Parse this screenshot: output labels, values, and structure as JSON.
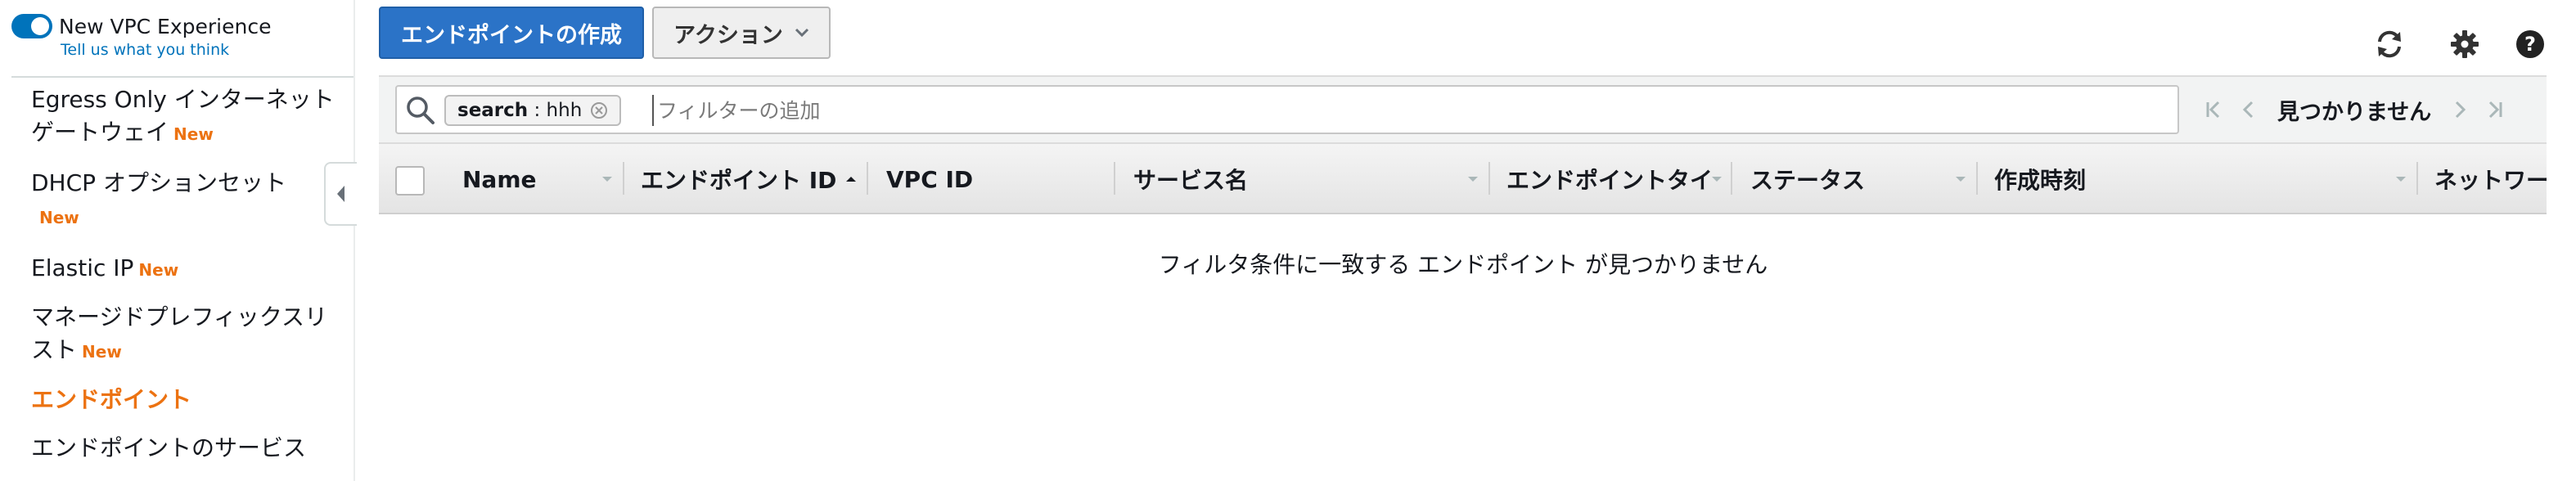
{
  "sidebar": {
    "toggle_label": "New VPC Experience",
    "feedback_link": "Tell us what you think",
    "new_badge": "New",
    "items": [
      {
        "label_line1": "Egress Only インターネット",
        "label_line2": "ゲートウェイ"
      },
      {
        "label_line1": "DHCP オプションセット"
      },
      {
        "label_line1": "Elastic IP"
      },
      {
        "label_line1": "マネージドプレフィックスリ",
        "label_line2": "スト"
      },
      {
        "label_line1": "エンドポイント"
      },
      {
        "label_line1": "エンドポイントのサービス"
      }
    ]
  },
  "toolbar": {
    "create_button": "エンドポイントの作成",
    "actions_button": "アクション"
  },
  "filter": {
    "token_key": "search",
    "token_sep": ":",
    "token_value": "hhh",
    "placeholder": "フィルターの追加"
  },
  "pager": {
    "status": "見つかりません"
  },
  "table": {
    "columns": [
      "Name",
      "エンドポイント ID",
      "VPC ID",
      "サービス名",
      "エンドポイントタイ",
      "ステータス",
      "作成時刻",
      "ネットワー"
    ],
    "empty_message": "フィルタ条件に一致する エンドポイント が見つかりません"
  },
  "colors": {
    "accent": "#0073bb",
    "primary_button": "#2b73c7",
    "active_nav": "#ec7211",
    "new_badge": "#ec7211"
  },
  "icons": [
    "refresh-icon",
    "settings-gear-icon",
    "help-icon",
    "search-icon",
    "token-remove-icon",
    "collapse-chevron-icon",
    "first-page-icon",
    "prev-page-icon",
    "next-page-icon",
    "last-page-icon",
    "sort-caret-icon"
  ]
}
